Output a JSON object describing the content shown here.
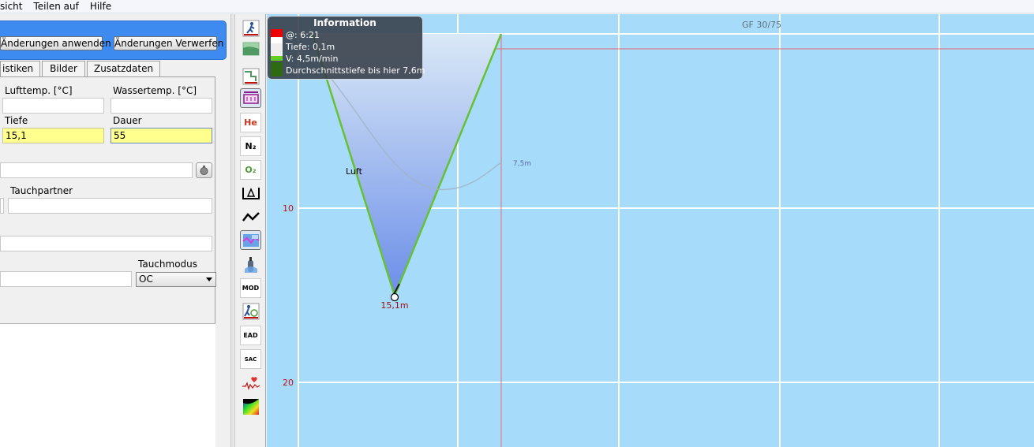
{
  "menubar": {
    "items": [
      "sicht",
      "Teilen auf",
      "Hilfe"
    ]
  },
  "actions": {
    "apply_label": "Änderungen anwenden",
    "discard_label": "Änderungen Verwerfen"
  },
  "tabs": [
    "istiken",
    "Bilder",
    "Zusatzdaten"
  ],
  "form": {
    "air_temp_label": "Lufttemp. [°C]",
    "air_temp_value": "",
    "water_temp_label": "Wassertemp. [°C]",
    "water_temp_value": "",
    "depth_label": "Tiefe",
    "depth_value": "15,1",
    "duration_label": "Dauer",
    "duration_value": "55",
    "location_value": "",
    "buddy_label": "Tauchpartner",
    "buddy_value": "",
    "suit_value": "",
    "dive_mode_label": "Tauchmodus",
    "dive_mode_value": "OC",
    "notes_value": ""
  },
  "toolbar": {
    "icons": [
      "ceiling-diver-icon",
      "calculated-ceiling-icon",
      "increment-ceiling-icon",
      "ruler-icon",
      "he-icon",
      "n2-icon",
      "o2-icon",
      "delta-ruler-icon",
      "profile-line-icon",
      "heatmap-toggle-icon",
      "tank-icon",
      "mod-icon",
      "ndl-icon",
      "ead-icon",
      "sac-icon",
      "heartrate-icon",
      "tissue-heatmap-icon"
    ],
    "he_label": "He",
    "n2_label": "N₂",
    "o2_label": "O₂",
    "mod_label": "MOD",
    "ead_label": "EAD",
    "sac_label": "SAC"
  },
  "plot": {
    "gf_label": "GF 30/75",
    "depth_ticks": [
      "10",
      "20"
    ],
    "gas_label": "Luft",
    "max_depth_label": "15,1m",
    "avg_depth_label": "7,5m",
    "colors": {
      "background": "#a6dbf9",
      "profile_line": "#66c133",
      "ticks": "#c01010"
    }
  },
  "info": {
    "title": "Information",
    "time": "@: 6:21",
    "depth": "Tiefe: 0,1m",
    "speed": "V: 4,5m/min",
    "avg_depth": "Durchschnittstiefe bis hier 7,6m"
  }
}
